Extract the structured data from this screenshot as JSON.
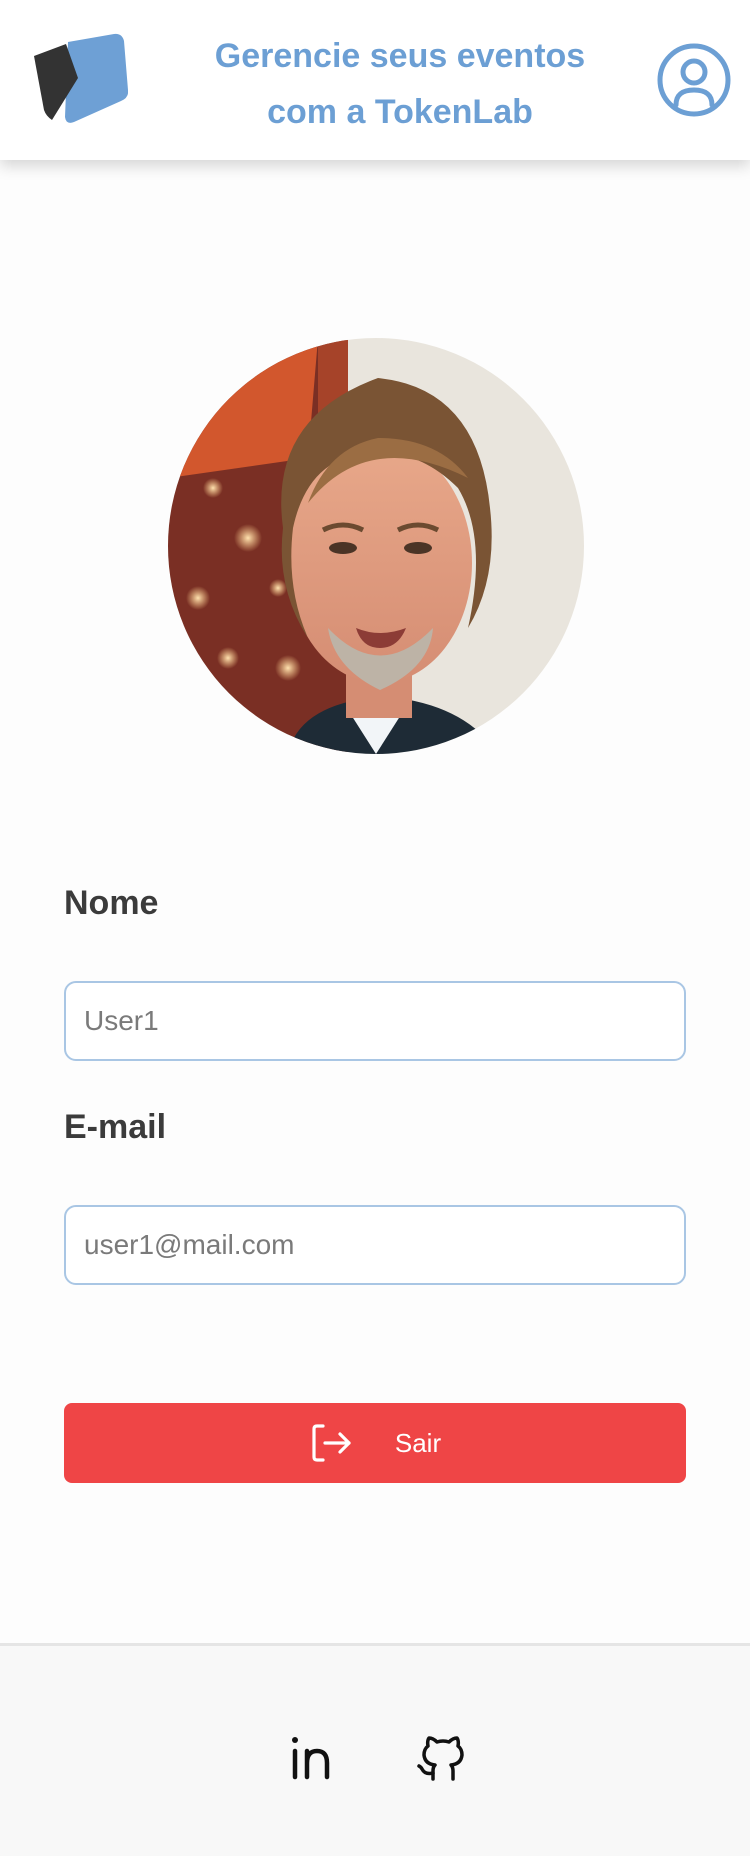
{
  "header": {
    "title_line1": "Gerencie seus eventos",
    "title_line2": "com a TokenLab",
    "logo_icon": "tokenlab-logo",
    "account_icon": "user-circle-icon"
  },
  "profile": {
    "avatar_alt": "Foto de perfil"
  },
  "form": {
    "name_label": "Nome",
    "name_placeholder": "User1",
    "email_label": "E-mail",
    "email_placeholder": "user1@mail.com"
  },
  "actions": {
    "logout_label": "Sair",
    "logout_icon": "logout-icon"
  },
  "footer": {
    "links": [
      {
        "icon": "linkedin-icon"
      },
      {
        "icon": "github-icon"
      }
    ]
  },
  "colors": {
    "accent": "#6c9fd4",
    "danger": "#ef4546",
    "input_border": "#a9c6e4"
  }
}
